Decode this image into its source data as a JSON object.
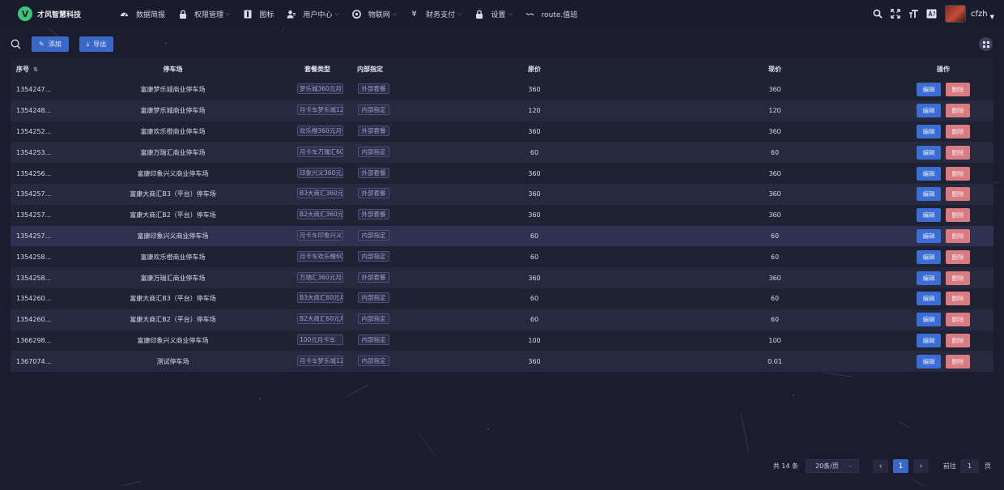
{
  "brand": {
    "logo_letter": "V",
    "name": "才风智慧科技"
  },
  "nav": [
    {
      "icon": "dashboard-icon",
      "label": "数据简报",
      "has_caret": false
    },
    {
      "icon": "lock-icon",
      "label": "权限管理",
      "has_caret": true
    },
    {
      "icon": "info-icon",
      "label": "图标",
      "has_caret": false
    },
    {
      "icon": "user-icon",
      "label": "用户中心",
      "has_caret": true
    },
    {
      "icon": "iot-icon",
      "label": "物联网",
      "has_caret": true
    },
    {
      "icon": "yen-icon",
      "label": "财务支付",
      "has_caret": true
    },
    {
      "icon": "lock-icon",
      "label": "设置",
      "has_caret": true
    },
    {
      "icon": "route-icon",
      "label": "route.值班",
      "has_caret": false
    }
  ],
  "user": {
    "name": "cfzh"
  },
  "toolbar": {
    "add_label": "添加",
    "export_label": "导出"
  },
  "table": {
    "headers": {
      "id": "序号",
      "lot": "停车场",
      "type": "套餐类型",
      "flag": "内部指定",
      "orig": "原价",
      "cur": "现价",
      "ops": "操作"
    },
    "edit_label": "编辑",
    "delete_label": "删除",
    "rows": [
      {
        "id": "1354247...",
        "lot": "富康梦乐城商业停车场",
        "type": "梦乐城360元月卡",
        "flag": "外部套餐",
        "orig": "360",
        "cur": "360"
      },
      {
        "id": "1354248...",
        "lot": "富康梦乐城商业停车场",
        "type": "月卡车梦乐城120",
        "flag": "内部指定",
        "orig": "120",
        "cur": "120"
      },
      {
        "id": "1354252...",
        "lot": "富康欢乐橙商业停车场",
        "type": "欢乐橙360元月卡",
        "flag": "外部套餐",
        "orig": "360",
        "cur": "360"
      },
      {
        "id": "1354253...",
        "lot": "富康万瑞汇商业停车场",
        "type": "月卡车万瑞汇60",
        "flag": "内部指定",
        "orig": "60",
        "cur": "60"
      },
      {
        "id": "1354256...",
        "lot": "富康印象兴义商业停车场",
        "type": "印象兴义360元月卡",
        "flag": "外部套餐",
        "orig": "360",
        "cur": "360"
      },
      {
        "id": "1354257...",
        "lot": "富康大商汇B3（平台）停车场",
        "type": "B3大商汇360元月卡",
        "flag": "外部套餐",
        "orig": "360",
        "cur": "360"
      },
      {
        "id": "1354257...",
        "lot": "富康大商汇B2（平台）停车场",
        "type": "B2大商汇360元月卡",
        "flag": "外部套餐",
        "orig": "360",
        "cur": "360"
      },
      {
        "id": "1354257...",
        "lot": "富康印象兴义商业停车场",
        "type": "月卡车印象兴义60",
        "flag": "内部指定",
        "orig": "60",
        "cur": "60"
      },
      {
        "id": "1354258...",
        "lot": "富康欢乐橙商业停车场",
        "type": "月卡车欢乐橙60",
        "flag": "内部指定",
        "orig": "60",
        "cur": "60"
      },
      {
        "id": "1354258...",
        "lot": "富康万瑞汇商业停车场",
        "type": "万瑞汇360元月卡",
        "flag": "外部套餐",
        "orig": "360",
        "cur": "360"
      },
      {
        "id": "1354260...",
        "lot": "富康大商汇B3（平台）停车场",
        "type": "B3大商汇60元月卡",
        "flag": "内部指定",
        "orig": "60",
        "cur": "60"
      },
      {
        "id": "1354260...",
        "lot": "富康大商汇B2（平台）停车场",
        "type": "B2大商汇60元月卡",
        "flag": "内部指定",
        "orig": "60",
        "cur": "60"
      },
      {
        "id": "1366298...",
        "lot": "富康印象兴义商业停车场",
        "type": "100元月卡车",
        "flag": "内部指定",
        "orig": "100",
        "cur": "100"
      },
      {
        "id": "1367074...",
        "lot": "测试停车场",
        "type": "月卡车梦乐城12",
        "flag": "内部指定",
        "orig": "360",
        "cur": "0.01"
      }
    ]
  },
  "pagination": {
    "total": "共 14 条",
    "page_size": "20条/页",
    "current": "1",
    "jump_prefix": "前往",
    "jump_value": "1",
    "jump_suffix": "页"
  },
  "colors": {
    "background": "#1b1d2e",
    "primary": "#3a68c8",
    "danger": "#d87c82",
    "logo_green": "#3ec57a"
  }
}
